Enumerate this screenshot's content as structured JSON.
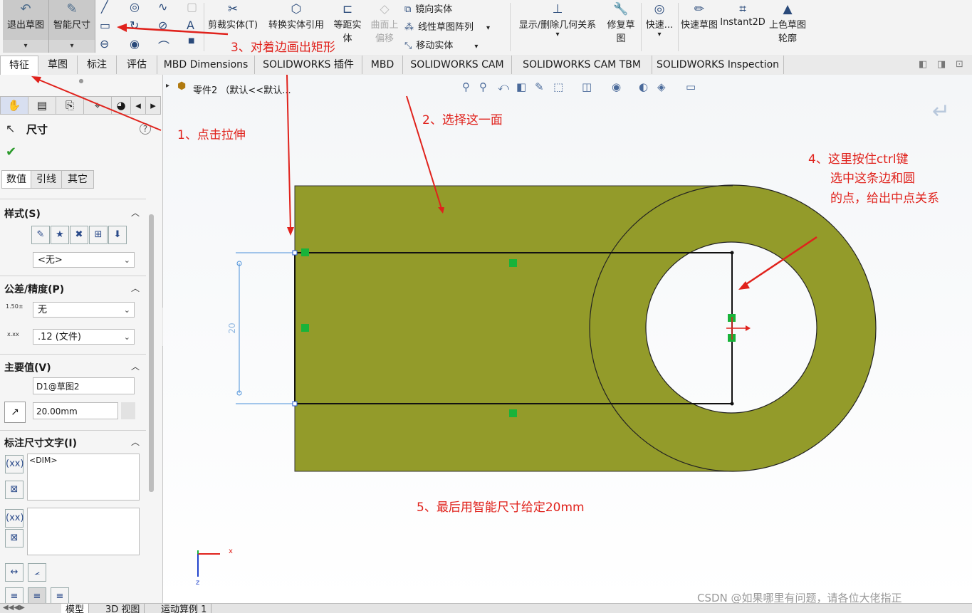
{
  "toolbar": {
    "exit_sketch": "退出草图",
    "smart_dim": "智能尺寸",
    "trim": "剪裁实体(T)",
    "convert": "转换实体引用",
    "offset": "等距实体",
    "offset_surface": "曲面上偏移",
    "mirror": "镜向实体",
    "linear_pattern": "线性草图阵列",
    "move": "移动实体",
    "display_relations": "显示/删除几何关系",
    "repair": "修复草图",
    "quick1": "快速...",
    "quick_sketch": "快速草图",
    "instant2d": "Instant2D",
    "shaded": "上色草图轮廓"
  },
  "tabs": [
    "特征",
    "草图",
    "标注",
    "评估",
    "MBD Dimensions",
    "SOLIDWORKS 插件",
    "MBD",
    "SOLIDWORKS CAM",
    "SOLIDWORKS CAM TBM",
    "SOLIDWORKS Inspection"
  ],
  "panel": {
    "title": "尺寸",
    "subtabs": [
      "数值",
      "引线",
      "其它"
    ],
    "style_title": "样式(S)",
    "style_value": "<无>",
    "tol_title": "公差/精度(P)",
    "tol_value": "无",
    "precision_value": ".12 (文件)",
    "primary_title": "主要值(V)",
    "primary_name": "D1@草图2",
    "primary_value": "20.00mm",
    "dimtext_title": "标注尺寸文字(I)",
    "dimtext_value": "<DIM>"
  },
  "tree": {
    "part": "零件2 （默认<<默认..."
  },
  "canvas": {
    "dim_label": "20",
    "triad_x": "x",
    "triad_z": "z",
    "watermark": "CSDN @如果哪里有问题，请各位大佬指正"
  },
  "annotations": {
    "a1": "1、点击拉伸",
    "a2": "2、选择这一面",
    "a3": "3、对着边画出矩形",
    "a4_l1": "4、这里按住ctrl键",
    "a4_l2": "选中这条边和圆",
    "a4_l3": "的点，给出中点关系",
    "a5": "5、最后用智能尺寸给定20mm"
  },
  "bottom_tabs": [
    "模型",
    "3D 视图",
    "运动算例 1"
  ],
  "colors": {
    "part_fill": "#939b2a",
    "annotation": "#e0221c",
    "relation": "#18b33a",
    "dimension": "#4a90d9"
  }
}
